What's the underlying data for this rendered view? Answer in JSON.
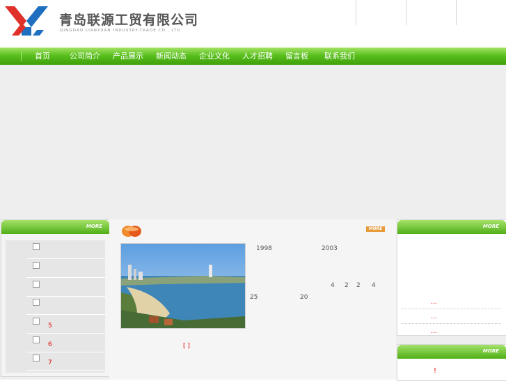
{
  "header": {
    "company_name": "青岛联源工贸有限公司",
    "company_name_en": "QINGDAO LIANYUAN INDUSTRY-TRADE CO., LTD."
  },
  "nav": {
    "items": [
      {
        "label": "首页"
      },
      {
        "label": "公司简介"
      },
      {
        "label": "产品展示"
      },
      {
        "label": "新闻动态"
      },
      {
        "label": "企业文化"
      },
      {
        "label": "人才招聘"
      },
      {
        "label": "留言板"
      },
      {
        "label": "联系我们"
      }
    ]
  },
  "left_panel": {
    "more_label": "MORE",
    "rows": [
      {
        "text": ""
      },
      {
        "text": ""
      },
      {
        "text": ""
      },
      {
        "text": ""
      },
      {
        "text": "5"
      },
      {
        "text": "6"
      },
      {
        "text": "7"
      }
    ]
  },
  "middle_panel": {
    "more_label": "MORE",
    "text_1998": "1998",
    "text_2003": "2003",
    "text_4a": "4",
    "text_2a": "2",
    "text_2b": "2",
    "text_4b": "4",
    "text_25": "25",
    "text_20": "20",
    "bracket_text": "[  ]"
  },
  "right_panel": {
    "more_label": "MORE",
    "news": [
      {
        "text": "..."
      },
      {
        "text": "..."
      },
      {
        "text": "..."
      }
    ]
  },
  "right_panel2": {
    "more_label": "MORE",
    "text": "!"
  },
  "colors": {
    "nav_green": "#4fae16",
    "accent_red": "#e00000",
    "orange": "#e79a3a",
    "logo_red": "#e0302a",
    "logo_blue": "#1e6fc0"
  }
}
